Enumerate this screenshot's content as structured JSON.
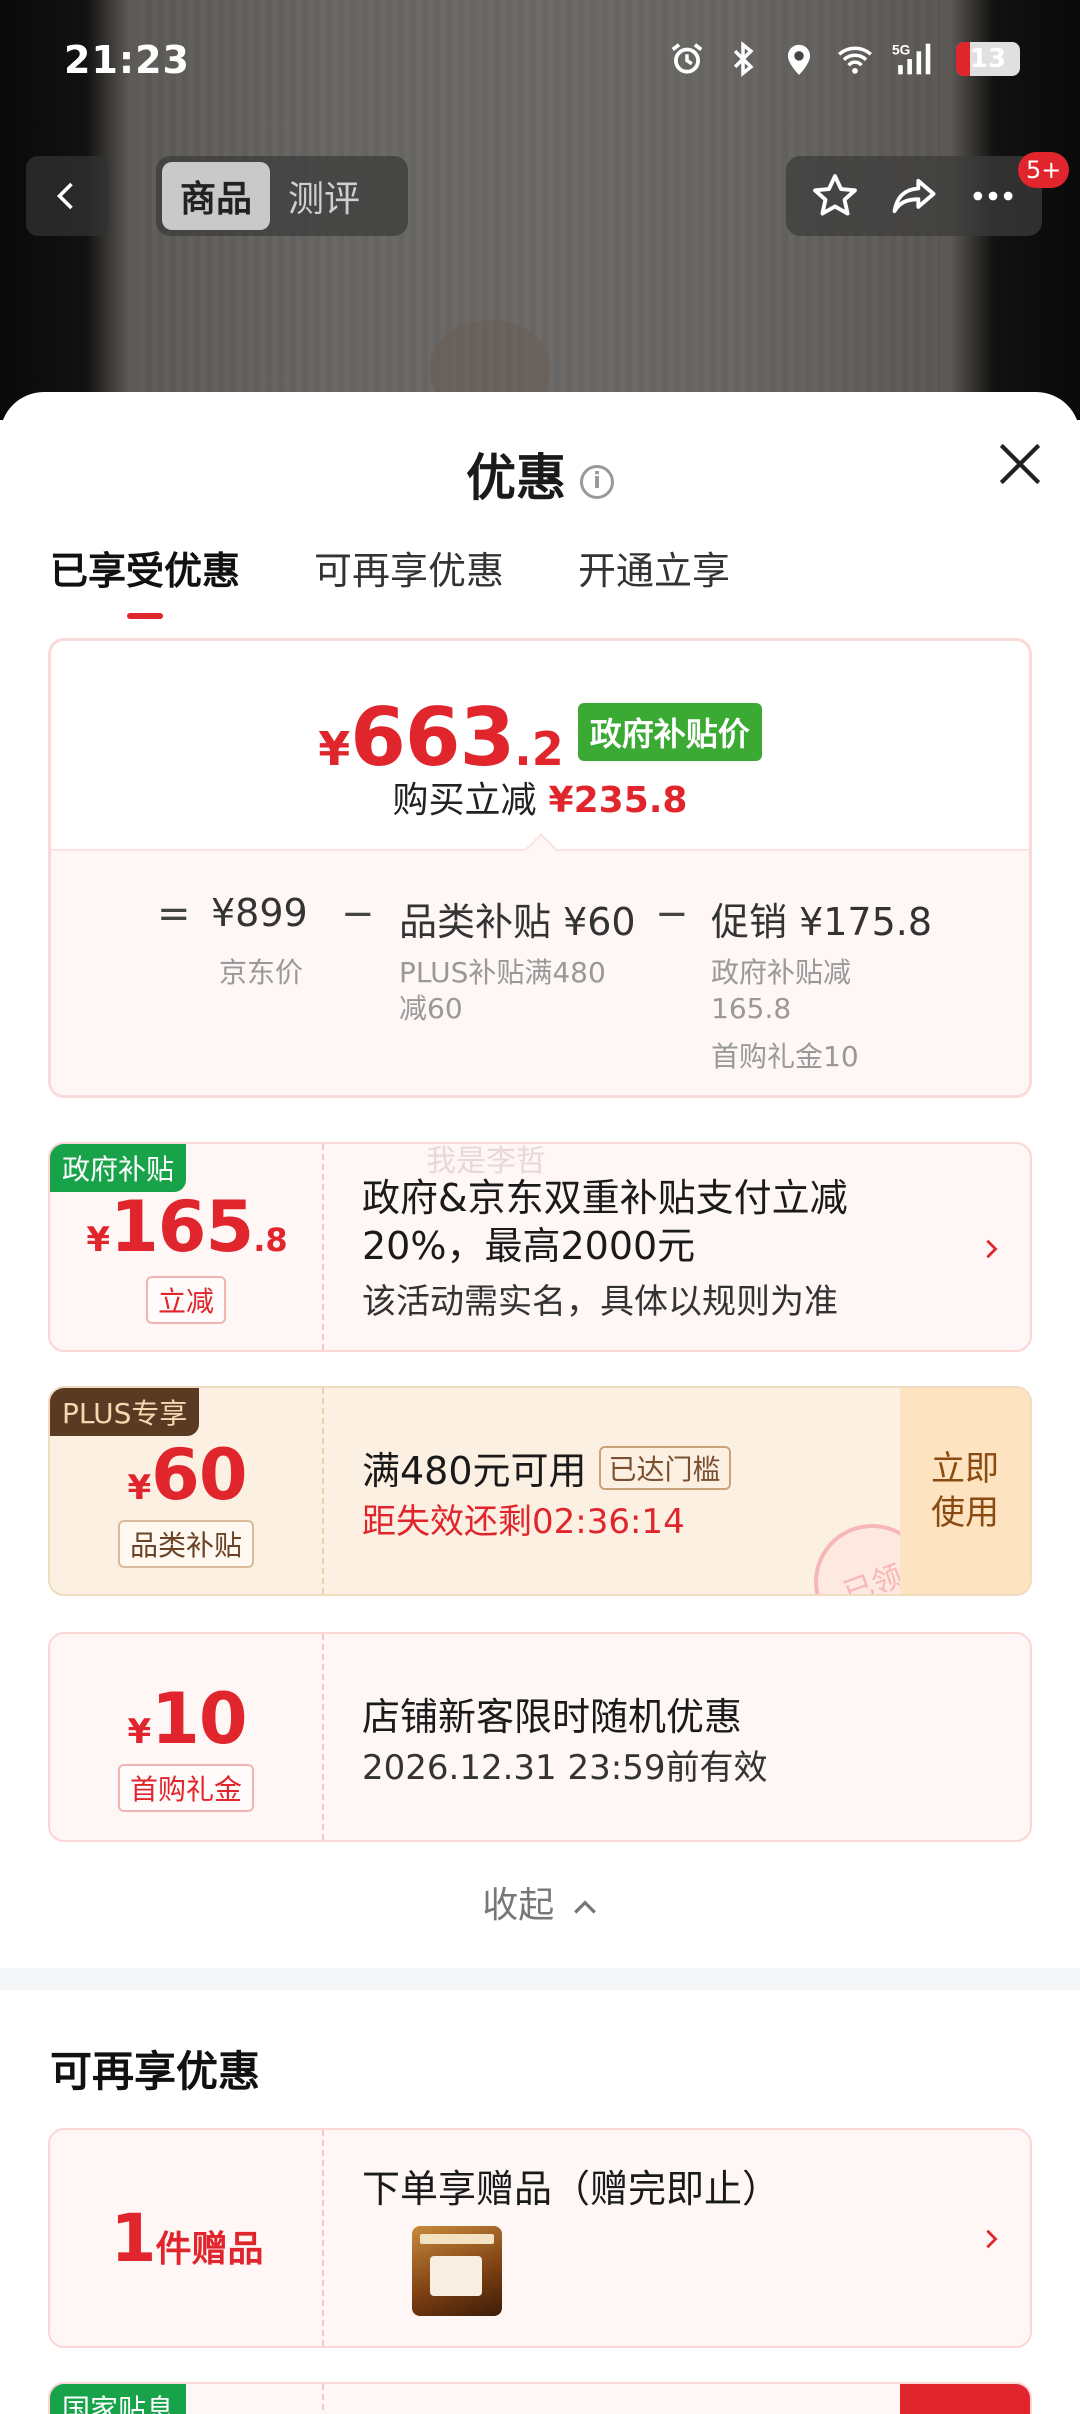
{
  "status_bar": {
    "time": "21:23",
    "icons": [
      "alarm-icon",
      "bluetooth-icon",
      "location-icon",
      "wifi-icon",
      "5g-signal-icon"
    ],
    "battery": "13"
  },
  "nav": {
    "tabs": [
      {
        "label": "商品",
        "active": true
      },
      {
        "label": "测评",
        "active": false
      }
    ],
    "message_badge": "5+"
  },
  "sheet": {
    "title": "优惠",
    "tabs": [
      {
        "label": "已享受优惠",
        "active": true
      },
      {
        "label": "可再享优惠",
        "active": false
      },
      {
        "label": "开通立享",
        "active": false
      }
    ]
  },
  "summary": {
    "price_symbol": "¥",
    "price_int": "663",
    "price_dec": ".2",
    "price_tag": "政府补贴价",
    "reduce_label": "购买立减",
    "reduce_amount": "¥235.8",
    "calc": {
      "eq": "=",
      "base_value": "¥899",
      "base_label": "京东价",
      "minus1": "−",
      "item2_value": "品类补贴 ¥60",
      "item2_label": "PLUS补贴满480减60",
      "minus2": "−",
      "item3_value": "促销 ¥175.8",
      "item3_label_1": "政府补贴减165.8",
      "item3_label_2": "首购礼金10"
    }
  },
  "coupons": [
    {
      "tag": "政府补贴",
      "symbol": "¥",
      "amount_int": "165",
      "amount_dec": ".8",
      "pill": "立减",
      "title": "政府&京东双重补贴支付立减20%，最高2000元",
      "subtitle": "该活动需实名，具体以规则为准",
      "watermark": "我是李哲"
    },
    {
      "tag": "PLUS专享",
      "symbol": "¥",
      "amount_int": "60",
      "pill": "品类补贴",
      "title": "满480元可用",
      "status_badge": "已达门槛",
      "countdown": "距失效还剩02:36:14",
      "action": "立即使用",
      "stamp": "已领"
    },
    {
      "symbol": "¥",
      "amount_int": "10",
      "pill": "首购礼金",
      "title": "店铺新客限时随机优惠",
      "subtitle": "2026.12.31 23:59前有效"
    }
  ],
  "collapse_label": "收起",
  "more_section": {
    "title": "可再享优惠",
    "gift": {
      "amount": "1",
      "unit": "件赠品",
      "title": "下单享赠品（赠完即止）",
      "thumb_icon": "gift-product-thumbnail"
    },
    "next_tag": "国家贴息"
  },
  "colors": {
    "accent_red": "#e0262c",
    "gov_green": "#3aaa35",
    "plus_brown": "#5b3a24",
    "card_bg": "#fff6f6"
  }
}
